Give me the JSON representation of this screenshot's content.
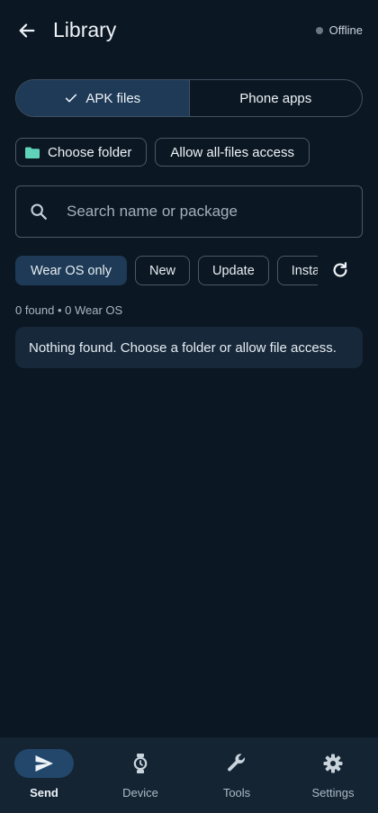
{
  "header": {
    "title": "Library",
    "status": "Offline",
    "back_icon": "arrow-left-icon"
  },
  "source_toggle": {
    "options": [
      {
        "label": "APK files",
        "selected": true
      },
      {
        "label": "Phone apps",
        "selected": false
      }
    ]
  },
  "actions": {
    "choose_folder": "Choose folder",
    "allow_access": "Allow all-files access"
  },
  "search": {
    "placeholder": "Search name or package",
    "value": ""
  },
  "filters": {
    "chips": [
      {
        "label": "Wear OS only",
        "selected": true
      },
      {
        "label": "New",
        "selected": false
      },
      {
        "label": "Update",
        "selected": false
      },
      {
        "label": "Installed",
        "selected": false
      }
    ]
  },
  "results": {
    "count_text": "0 found • 0 Wear OS",
    "empty_message": "Nothing found. Choose a folder or allow file access."
  },
  "bottom_nav": {
    "items": [
      {
        "label": "Send",
        "icon": "send-icon",
        "active": true
      },
      {
        "label": "Device",
        "icon": "watch-icon",
        "active": false
      },
      {
        "label": "Tools",
        "icon": "wrench-icon",
        "active": false
      },
      {
        "label": "Settings",
        "icon": "gear-icon",
        "active": false
      }
    ]
  },
  "colors": {
    "background": "#0b1722",
    "accent": "#1e3a56",
    "folder": "#5fd3b8",
    "nav_background": "#142433"
  }
}
